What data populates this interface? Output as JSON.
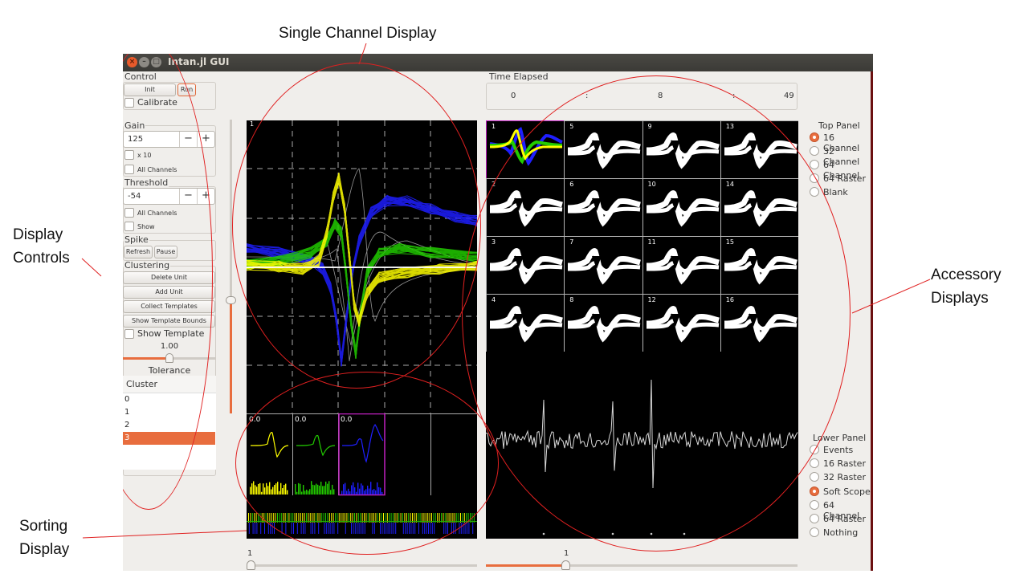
{
  "callouts": {
    "single_channel": "Single Channel Display",
    "display_controls": [
      "Display",
      "Controls"
    ],
    "accessory": [
      "Accessory",
      "Displays"
    ],
    "sorting": [
      "Sorting",
      "Display"
    ]
  },
  "window": {
    "title": "Intan.jl GUI",
    "buttons": [
      "close",
      "minimize",
      "maximize"
    ]
  },
  "control": {
    "label": "Control",
    "init_label": "Init",
    "run_label": "Run",
    "calibrate_label": "Calibrate"
  },
  "gain": {
    "label": "Gain",
    "value": "125",
    "minus": "−",
    "plus": "+",
    "x10_label": "x 10",
    "all_channels_label": "All Channels"
  },
  "threshold": {
    "label": "Threshold",
    "value": "-54",
    "minus": "−",
    "plus": "+",
    "all_channels_label": "All Channels",
    "show_label": "Show"
  },
  "spike": {
    "label": "Spike",
    "refresh_label": "Refresh",
    "pause_label": "Pause"
  },
  "clustering": {
    "label": "Clustering",
    "buttons": [
      "Delete Unit",
      "Add Unit",
      "Collect Templates",
      "Show Template Bounds"
    ],
    "show_template_label": "Show Template",
    "tolerance_value": "1.00",
    "tolerance_fraction": 0.5,
    "tolerance_label": "Tolerance",
    "list_header": "Cluster",
    "list_items": [
      "0",
      "1",
      "2",
      "3"
    ],
    "selected_index": 3
  },
  "time_elapsed": {
    "label": "Time Elapsed",
    "hours": "0",
    "sep1": ":",
    "minutes": "8",
    "sep2": ":",
    "seconds": "49"
  },
  "single_channel": {
    "channel_number": "1",
    "sorting_labels": [
      "0.0",
      "0.0",
      "0.0"
    ],
    "slider_value": "1"
  },
  "accessory": {
    "grid_numbers": [
      "1",
      "5",
      "9",
      "13",
      "2",
      "6",
      "10",
      "14",
      "3",
      "7",
      "11",
      "15",
      "4",
      "8",
      "12",
      "16"
    ],
    "slider_value": "1"
  },
  "top_panel": {
    "label": "Top Panel",
    "options": [
      "16 Channel",
      "32 Channel",
      "64 Channel",
      "64 Raster",
      "Blank"
    ],
    "selected": 0
  },
  "lower_panel": {
    "label": "Lower Panel",
    "options": [
      "Events",
      "16 Raster",
      "32 Raster",
      "Soft Scope",
      "64 Channel",
      "64 Raster",
      "Nothing"
    ],
    "selected": 3
  },
  "colors": {
    "accent": "#e86d3e",
    "unit_yellow": "#ffff00",
    "unit_green": "#22cc00",
    "unit_blue": "#1f1fff",
    "selected_frame": "#c020c0",
    "annotation_red": "#e02020"
  }
}
